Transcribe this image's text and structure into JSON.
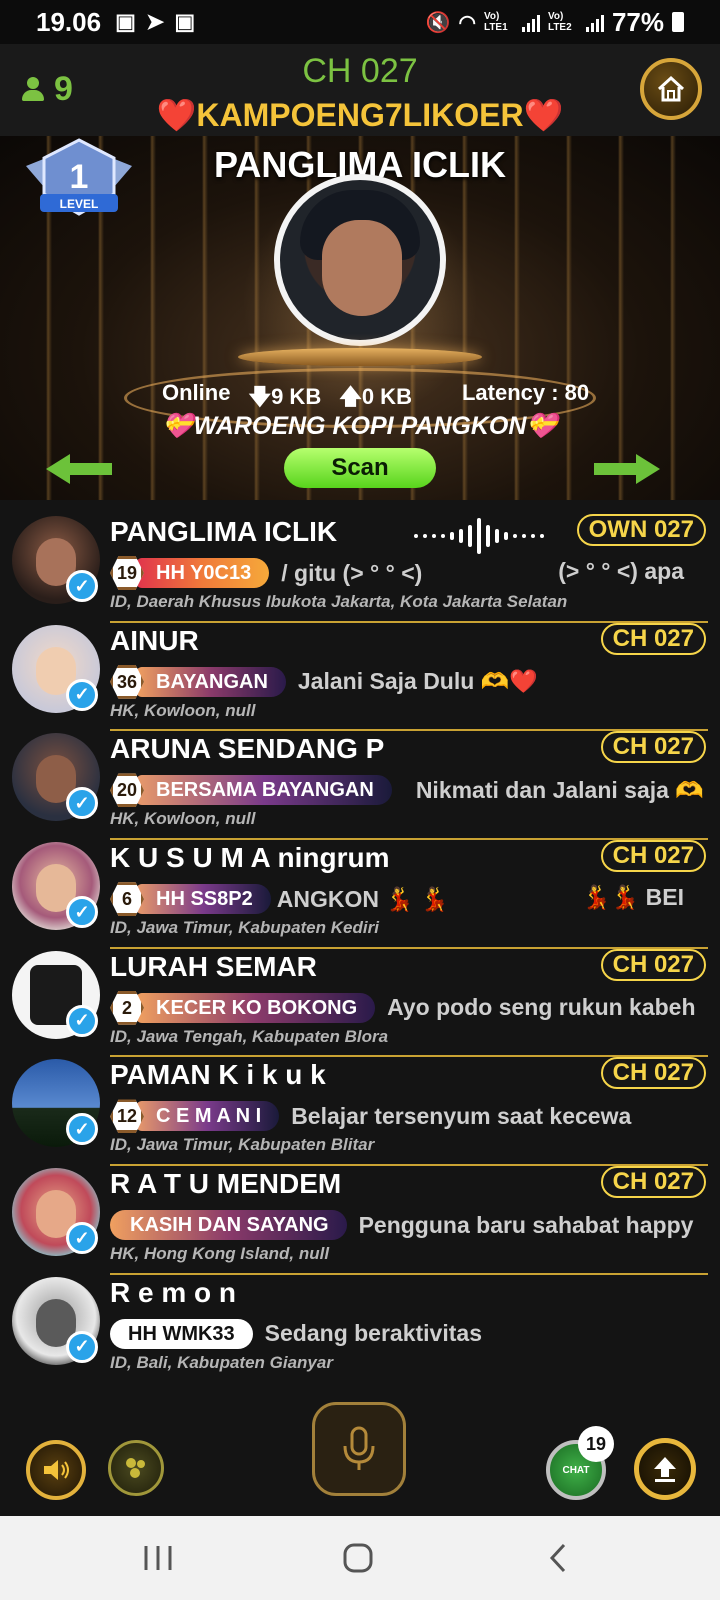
{
  "status_bar": {
    "time": "19.06",
    "battery": "77%",
    "sim1": "Vo) LTE1",
    "sim2": "Vo) LTE2",
    "app_icons": [
      "facebook-icon",
      "telegram-icon",
      "facebook-icon"
    ]
  },
  "header": {
    "user_count": "9",
    "channel": "CH 027",
    "room_name": "❤️KAMPOENG7LIKOER❤️"
  },
  "stage": {
    "level_label": "LEVEL",
    "level_number": "1",
    "host_name": "PANGLIMA ICLIK",
    "online_label": "Online",
    "download": "9 KB",
    "upload": "0 KB",
    "latency": "Latency : 80",
    "topic": "💝WAROENG KOPI PANGKON💝",
    "scan_label": "Scan"
  },
  "members": [
    {
      "name": "PANGLIMA ICLIK",
      "badge": "OWN 027",
      "level": "19",
      "tag": "HH Y0C13",
      "message": "/ gitu (> ° ° <)",
      "message2": "(> ° ° <) apa",
      "location": "ID, Daerah Khusus Ibukota Jakarta, Kota Jakarta Selatan"
    },
    {
      "name": "AINUR",
      "badge": "CH 027",
      "level": "36",
      "tag": "BAYANGAN",
      "message": "Jalani Saja Dulu 🫶❤️",
      "location": "HK, Kowloon, null"
    },
    {
      "name": "ARUNA SENDANG P",
      "badge": "CH 027",
      "level": "20",
      "tag": "BERSAMA BAYANGAN",
      "message": "Nikmati dan Jalani saja 🫶",
      "location": "HK, Kowloon, null"
    },
    {
      "name": "K U S U M A ningrum",
      "badge": "CH 027",
      "level": "6",
      "tag": "HH SS8P2",
      "message": "ANGKON 💃 💃",
      "message2": "💃💃 BEI",
      "location": "ID, Jawa Timur, Kabupaten Kediri"
    },
    {
      "name": "LURAH SEMAR",
      "badge": "CH 027",
      "level": "2",
      "tag": "KECER KO BOKONG",
      "message": "Ayo podo seng rukun kabeh",
      "location": "ID, Jawa Tengah, Kabupaten Blora"
    },
    {
      "name": "PAMAN K i k u k",
      "badge": "CH 027",
      "level": "12",
      "tag": "C E M A N I",
      "message": "Belajar tersenyum saat kecewa",
      "location": "ID, Jawa Timur, Kabupaten Blitar"
    },
    {
      "name": "R A T U   MENDEM",
      "badge": "CH 027",
      "level": "",
      "tag": "KASIH DAN SAYANG",
      "message": "Pengguna baru sahabat happy",
      "location": "HK, Hong Kong Island, null"
    },
    {
      "name": "R e m o n",
      "badge": "",
      "level": "",
      "tag": "HH WMK33",
      "message": "Sedang beraktivitas",
      "location": "ID, Bali, Kabupaten Gianyar"
    }
  ],
  "bottom_bar": {
    "chat_label": "CHAT",
    "chat_count": "19"
  },
  "colors": {
    "accent_green": "#7cc242",
    "accent_gold": "#f6d54a",
    "verify_blue": "#2aa3e9"
  }
}
